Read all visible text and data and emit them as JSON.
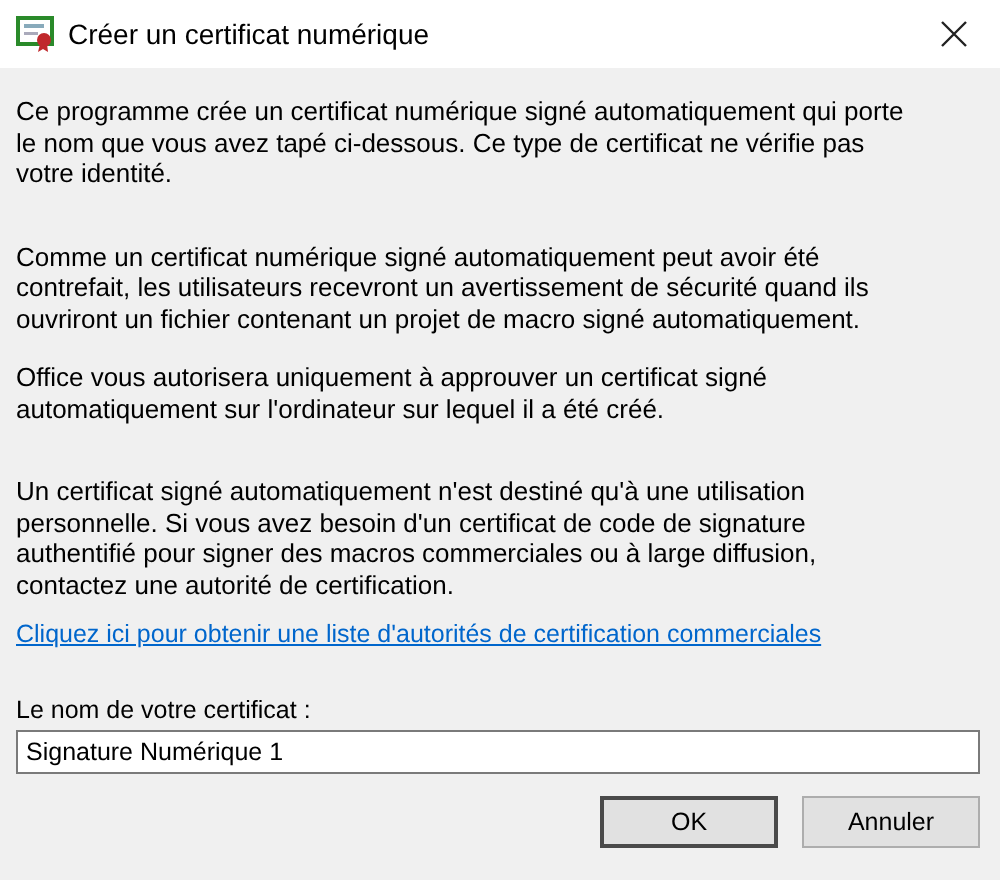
{
  "window": {
    "title": "Créer un certificat numérique"
  },
  "paragraphs": [
    "Ce programme crée un certificat numérique signé automatiquement qui porte le nom que vous avez tapé ci-dessous. Ce type de certificat ne vérifie pas votre identité.",
    "Comme un certificat numérique signé automatiquement peut avoir été contrefait, les utilisateurs recevront un avertissement de sécurité quand ils ouvriront un fichier contenant un projet de macro signé automatiquement.",
    "Office vous autorisera uniquement à approuver un certificat signé automatiquement sur l'ordinateur sur lequel il a été créé.",
    "Un certificat signé automatiquement n'est destiné qu'à une utilisation personnelle. Si vous avez besoin d'un certificat de code de signature authentifié pour signer des macros commerciales ou à large diffusion, contactez une autorité de certification."
  ],
  "link": "Cliquez ici pour obtenir une liste d'autorités de certification commerciales",
  "name_field": {
    "label": "Le nom de votre certificat :",
    "value": "Signature Numérique 1"
  },
  "buttons": [
    {
      "label": "OK",
      "default": true
    },
    {
      "label": "Annuler",
      "default": false
    }
  ]
}
